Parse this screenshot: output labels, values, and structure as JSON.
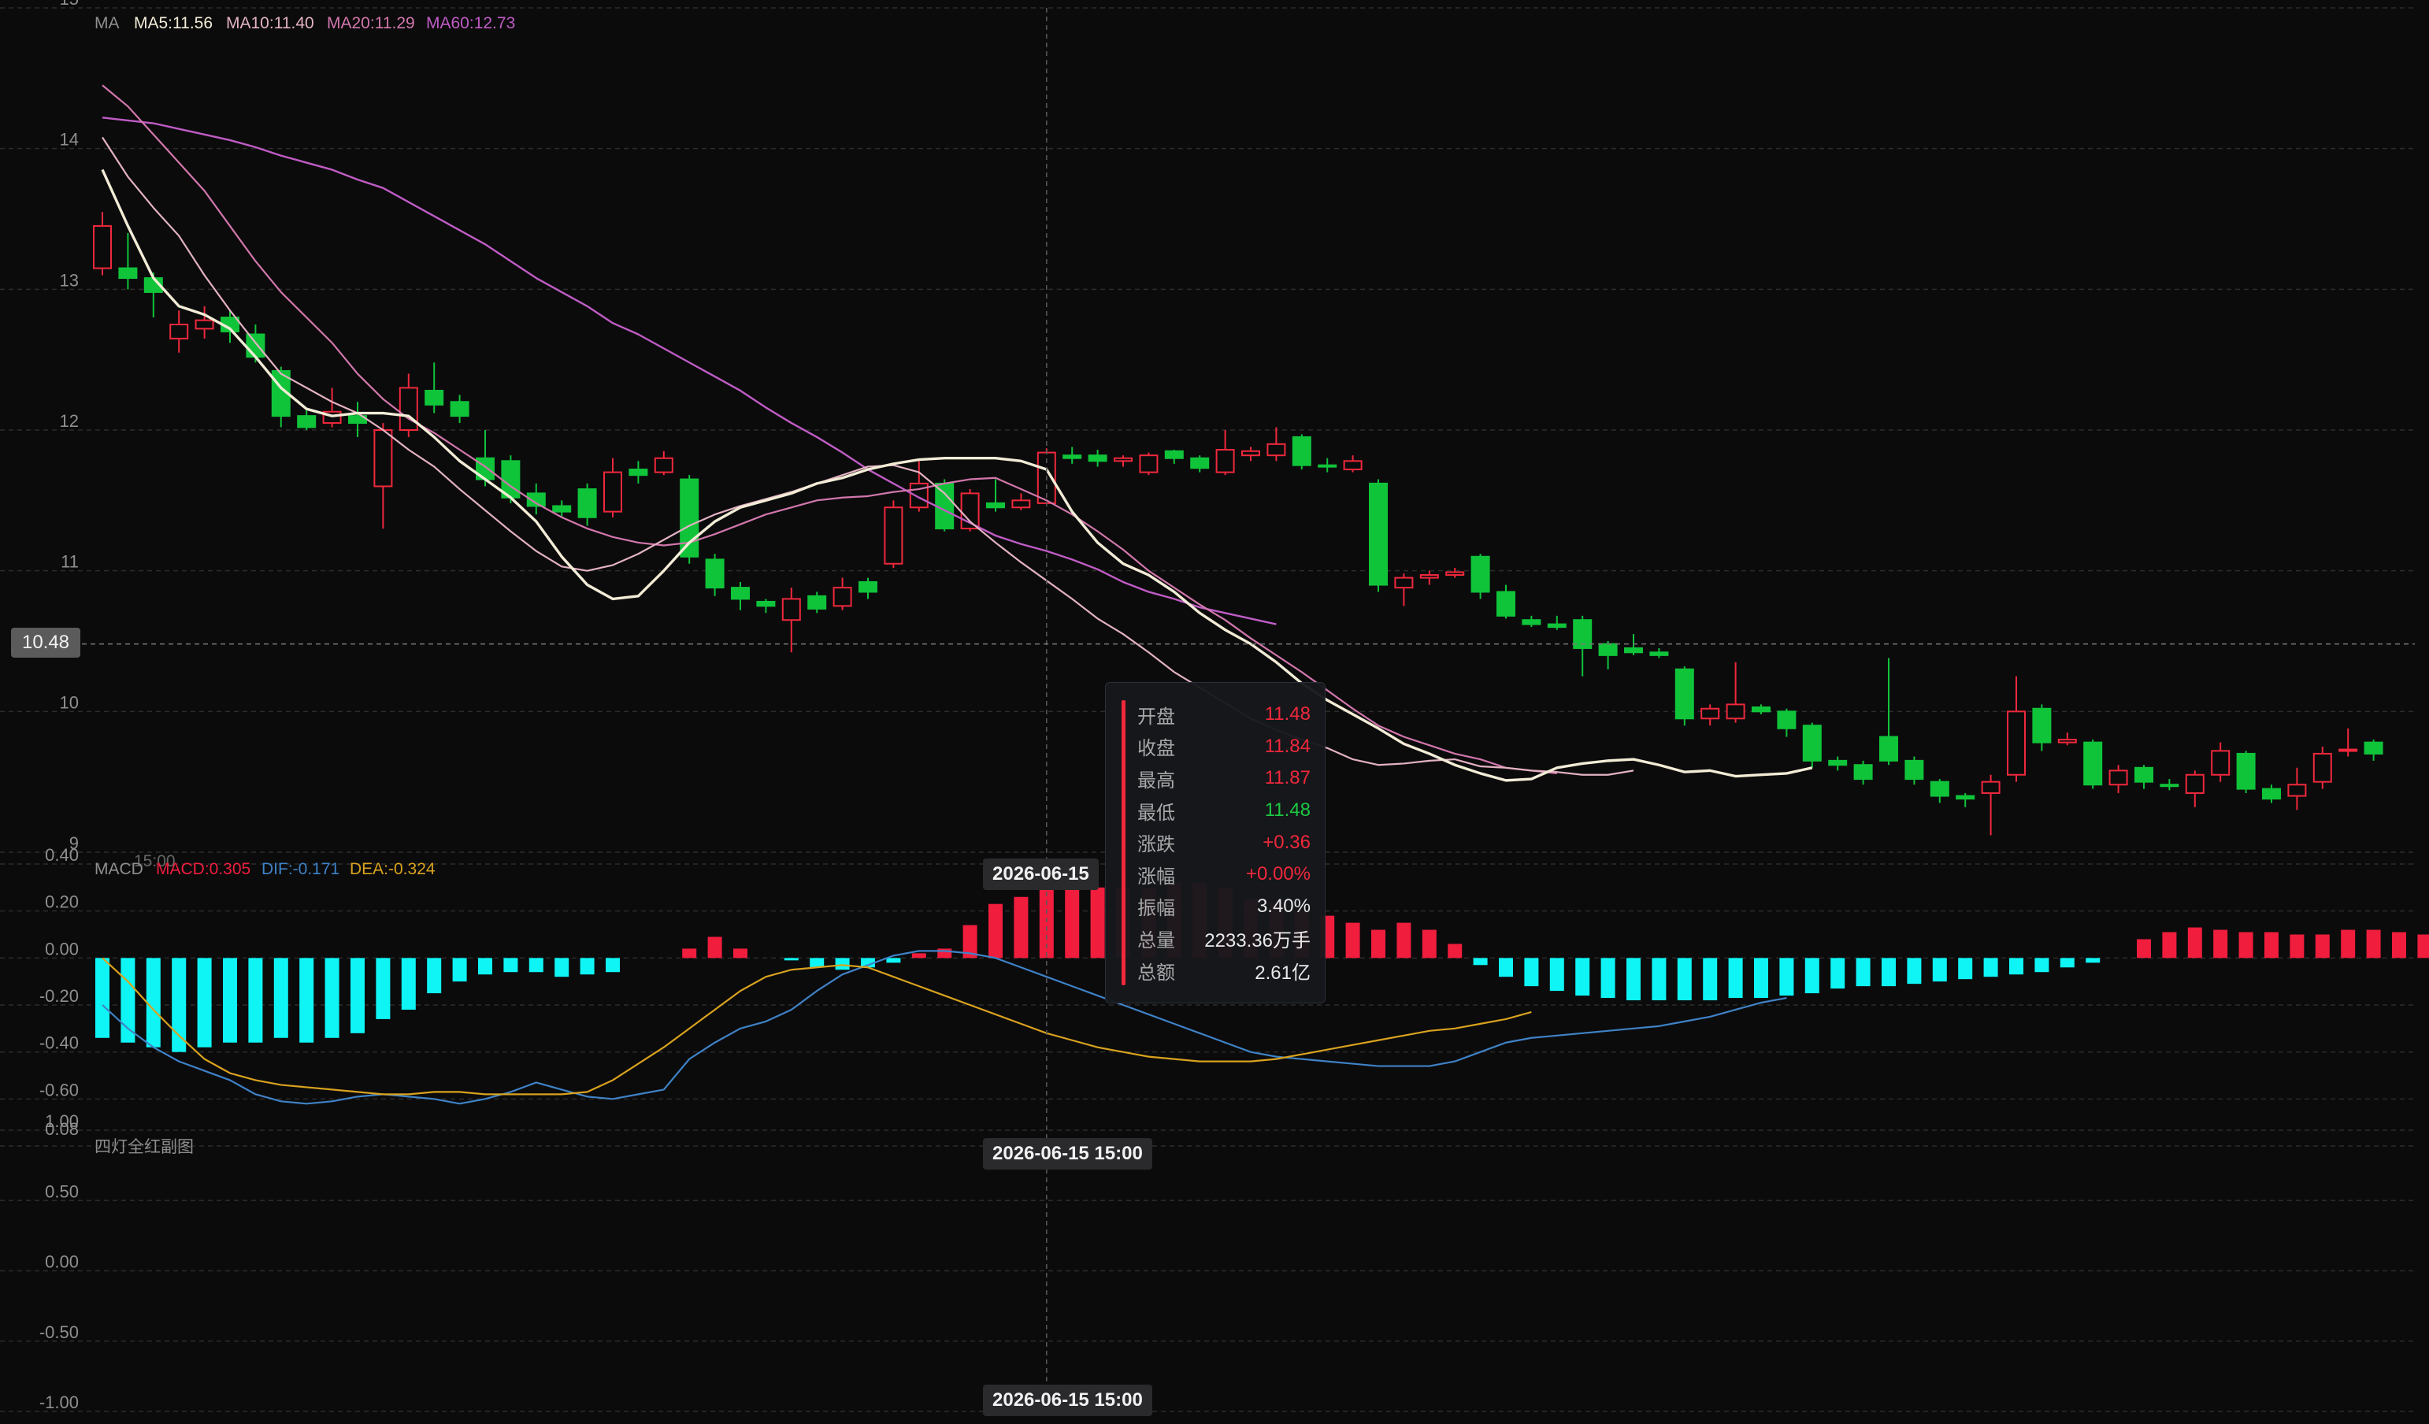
{
  "colors": {
    "up": "#f0283c",
    "down": "#10c43a",
    "ma5": "#f2ecd6",
    "ma10": "#e3b2c2",
    "ma20": "#d277ac",
    "ma60": "#c05cc5",
    "macd_pos": "#f01d3d",
    "macd_neg": "#0ff5f5",
    "dif": "#3f82c6",
    "dea": "#d9a21e",
    "grid": "#2c2c2c"
  },
  "main_legend": {
    "title": "MA",
    "ma5": "MA5:11.56",
    "ma10": "MA10:11.40",
    "ma20": "MA20:11.29",
    "ma60": "MA60:12.73"
  },
  "macd_legend": {
    "title": "MACD",
    "macd": "MACD:0.305",
    "dif": "DIF:-0.171",
    "dea": "DEA:-0.324"
  },
  "bottom_legend": {
    "title": "四灯全红副图"
  },
  "overlap_text": {
    "macd_time": "15:00",
    "bottom_tick": "0.08"
  },
  "crosshair": {
    "price_label": "10.48",
    "price_value": 10.48,
    "date_label_macd": "2026-06-15",
    "date_label_bottom1": "2026-06-15 15:00",
    "date_label_bottom2": "2026-06-15 15:00",
    "candle_index": 37
  },
  "tooltip": {
    "rows": [
      {
        "label": "开盘",
        "value": "11.48",
        "tone": "up"
      },
      {
        "label": "收盘",
        "value": "11.84",
        "tone": "up"
      },
      {
        "label": "最高",
        "value": "11.87",
        "tone": "up"
      },
      {
        "label": "最低",
        "value": "11.48",
        "tone": "down"
      },
      {
        "label": "涨跌",
        "value": "+0.36",
        "tone": "up"
      },
      {
        "label": "涨幅",
        "value": "+0.00%",
        "tone": "up"
      },
      {
        "label": "振幅",
        "value": "3.40%",
        "tone": "neutral"
      },
      {
        "label": "总量",
        "value": "2233.36万手",
        "tone": "neutral"
      },
      {
        "label": "总额",
        "value": "2.61亿",
        "tone": "neutral"
      }
    ]
  },
  "chart_data": [
    {
      "type": "candlestick",
      "title": "",
      "ylim": [
        9,
        15
      ],
      "yticks": [
        9,
        10,
        11,
        12,
        13,
        14,
        15
      ],
      "grid": true,
      "candles": [
        [
          13.15,
          13.45,
          13.55,
          13.1
        ],
        [
          13.15,
          13.08,
          13.4,
          13.0
        ],
        [
          13.08,
          12.98,
          13.12,
          12.8
        ],
        [
          12.65,
          12.75,
          12.85,
          12.55
        ],
        [
          12.72,
          12.78,
          12.88,
          12.65
        ],
        [
          12.8,
          12.7,
          12.85,
          12.62
        ],
        [
          12.68,
          12.52,
          12.75,
          12.48
        ],
        [
          12.42,
          12.1,
          12.45,
          12.02
        ],
        [
          12.1,
          12.02,
          12.15,
          12.0
        ],
        [
          12.05,
          12.13,
          12.3,
          12.02
        ],
        [
          12.1,
          12.05,
          12.2,
          11.95
        ],
        [
          11.6,
          12.0,
          12.05,
          11.3
        ],
        [
          12.0,
          12.3,
          12.4,
          11.95
        ],
        [
          12.28,
          12.18,
          12.48,
          12.12
        ],
        [
          12.2,
          12.1,
          12.25,
          12.05
        ],
        [
          11.8,
          11.65,
          12.0,
          11.6
        ],
        [
          11.78,
          11.52,
          11.82,
          11.48
        ],
        [
          11.55,
          11.46,
          11.62,
          11.4
        ],
        [
          11.46,
          11.42,
          11.5,
          11.38
        ],
        [
          11.58,
          11.38,
          11.62,
          11.32
        ],
        [
          11.42,
          11.7,
          11.8,
          11.38
        ],
        [
          11.72,
          11.68,
          11.78,
          11.62
        ],
        [
          11.7,
          11.8,
          11.85,
          11.68
        ],
        [
          11.65,
          11.1,
          11.68,
          11.05
        ],
        [
          11.08,
          10.88,
          11.12,
          10.82
        ],
        [
          10.88,
          10.8,
          10.92,
          10.72
        ],
        [
          10.78,
          10.75,
          10.8,
          10.7
        ],
        [
          10.65,
          10.8,
          10.88,
          10.42
        ],
        [
          10.82,
          10.73,
          10.85,
          10.7
        ],
        [
          10.75,
          10.88,
          10.95,
          10.72
        ],
        [
          10.92,
          10.85,
          10.95,
          10.8
        ],
        [
          11.05,
          11.45,
          11.5,
          11.02
        ],
        [
          11.45,
          11.62,
          11.78,
          11.42
        ],
        [
          11.62,
          11.3,
          11.65,
          11.28
        ],
        [
          11.3,
          11.55,
          11.58,
          11.28
        ],
        [
          11.48,
          11.45,
          11.65,
          11.42
        ],
        [
          11.45,
          11.5,
          11.55,
          11.43
        ],
        [
          11.48,
          11.84,
          11.87,
          11.48
        ],
        [
          11.82,
          11.8,
          11.88,
          11.76
        ],
        [
          11.82,
          11.78,
          11.86,
          11.74
        ],
        [
          11.78,
          11.8,
          11.82,
          11.74
        ],
        [
          11.7,
          11.82,
          11.84,
          11.68
        ],
        [
          11.85,
          11.8,
          11.86,
          11.76
        ],
        [
          11.8,
          11.73,
          11.82,
          11.7
        ],
        [
          11.7,
          11.86,
          12.0,
          11.68
        ],
        [
          11.82,
          11.85,
          11.88,
          11.78
        ],
        [
          11.82,
          11.9,
          12.02,
          11.78
        ],
        [
          11.95,
          11.75,
          11.97,
          11.72
        ],
        [
          11.75,
          11.74,
          11.8,
          11.7
        ],
        [
          11.72,
          11.78,
          11.82,
          11.7
        ],
        [
          11.62,
          10.9,
          11.65,
          10.85
        ],
        [
          10.88,
          10.95,
          10.98,
          10.75
        ],
        [
          10.95,
          10.97,
          11.0,
          10.9
        ],
        [
          10.97,
          10.99,
          11.02,
          10.95
        ],
        [
          11.1,
          10.85,
          11.12,
          10.8
        ],
        [
          10.85,
          10.68,
          10.9,
          10.66
        ],
        [
          10.65,
          10.62,
          10.68,
          10.6
        ],
        [
          10.62,
          10.6,
          10.68,
          10.58
        ],
        [
          10.65,
          10.45,
          10.68,
          10.25
        ],
        [
          10.48,
          10.4,
          10.5,
          10.3
        ],
        [
          10.45,
          10.42,
          10.55,
          10.4
        ],
        [
          10.42,
          10.4,
          10.45,
          10.38
        ],
        [
          10.3,
          9.95,
          10.32,
          9.9
        ],
        [
          9.95,
          10.02,
          10.05,
          9.9
        ],
        [
          9.95,
          10.05,
          10.35,
          9.92
        ],
        [
          10.03,
          10.0,
          10.05,
          9.98
        ],
        [
          10.0,
          9.88,
          10.02,
          9.82
        ],
        [
          9.9,
          9.65,
          9.92,
          9.6
        ],
        [
          9.65,
          9.62,
          9.68,
          9.58
        ],
        [
          9.62,
          9.52,
          9.65,
          9.48
        ],
        [
          9.82,
          9.65,
          10.38,
          9.62
        ],
        [
          9.65,
          9.52,
          9.68,
          9.48
        ],
        [
          9.5,
          9.4,
          9.52,
          9.35
        ],
        [
          9.4,
          9.38,
          9.42,
          9.32
        ],
        [
          9.42,
          9.5,
          9.55,
          9.12
        ],
        [
          9.55,
          10.0,
          10.25,
          9.5
        ],
        [
          10.02,
          9.78,
          10.05,
          9.72
        ],
        [
          9.78,
          9.8,
          9.85,
          9.76
        ],
        [
          9.78,
          9.48,
          9.8,
          9.45
        ],
        [
          9.48,
          9.58,
          9.62,
          9.42
        ],
        [
          9.6,
          9.5,
          9.62,
          9.45
        ],
        [
          9.48,
          9.47,
          9.52,
          9.44
        ],
        [
          9.42,
          9.55,
          9.58,
          9.32
        ],
        [
          9.55,
          9.72,
          9.78,
          9.5
        ],
        [
          9.7,
          9.45,
          9.72,
          9.42
        ],
        [
          9.45,
          9.38,
          9.48,
          9.35
        ],
        [
          9.4,
          9.48,
          9.6,
          9.3
        ],
        [
          9.5,
          9.7,
          9.75,
          9.45
        ],
        [
          9.72,
          9.73,
          9.88,
          9.68
        ],
        [
          9.78,
          9.7,
          9.8,
          9.65
        ]
      ],
      "ma5": [
        13.85,
        13.45,
        13.08,
        12.88,
        12.82,
        12.72,
        12.52,
        12.3,
        12.15,
        12.1,
        12.12,
        12.12,
        12.1,
        11.95,
        11.78,
        11.65,
        11.52,
        11.35,
        11.1,
        10.9,
        10.8,
        10.82,
        11.0,
        11.2,
        11.35,
        11.45,
        11.5,
        11.55,
        11.62,
        11.66,
        11.72,
        11.76,
        11.79,
        11.8,
        11.8,
        11.8,
        11.78,
        11.72,
        11.42,
        11.2,
        11.05,
        10.97,
        10.85,
        10.7,
        10.58,
        10.48,
        10.35,
        10.2,
        10.08,
        9.98,
        9.88,
        9.77,
        9.7,
        9.62,
        9.56,
        9.51,
        9.52,
        9.6,
        9.63,
        9.65,
        9.66,
        9.62,
        9.57,
        9.58,
        9.54,
        9.55,
        9.56,
        9.6
      ],
      "ma10": [
        14.08,
        13.8,
        13.58,
        13.38,
        13.1,
        12.85,
        12.62,
        12.4,
        12.3,
        12.2,
        12.12,
        12.0,
        11.86,
        11.74,
        11.58,
        11.43,
        11.28,
        11.14,
        11.03,
        11.0,
        11.04,
        11.12,
        11.22,
        11.32,
        11.4,
        11.46,
        11.51,
        11.56,
        11.62,
        11.68,
        11.74,
        11.75,
        11.7,
        11.55,
        11.35,
        11.2,
        11.06,
        10.93,
        10.8,
        10.66,
        10.55,
        10.42,
        10.28,
        10.17,
        10.06,
        9.95,
        9.87,
        9.8,
        9.74,
        9.66,
        9.62,
        9.63,
        9.65,
        9.66,
        9.61,
        9.6,
        9.58,
        9.57,
        9.55,
        9.55,
        9.58
      ],
      "ma20": [
        14.45,
        14.3,
        14.1,
        13.9,
        13.7,
        13.45,
        13.2,
        12.98,
        12.8,
        12.62,
        12.4,
        12.22,
        12.08,
        11.98,
        11.86,
        11.74,
        11.6,
        11.48,
        11.38,
        11.3,
        11.24,
        11.2,
        11.18,
        11.2,
        11.26,
        11.33,
        11.4,
        11.45,
        11.5,
        11.52,
        11.53,
        11.56,
        11.58,
        11.62,
        11.65,
        11.66,
        11.58,
        11.5,
        11.4,
        11.28,
        11.15,
        11.0,
        10.88,
        10.76,
        10.65,
        10.52,
        10.4,
        10.28,
        10.15,
        10.02,
        9.9,
        9.82,
        9.76,
        9.7,
        9.66,
        9.6,
        9.58,
        9.56
      ],
      "ma60": [
        14.22,
        14.2,
        14.18,
        14.14,
        14.1,
        14.06,
        14.01,
        13.95,
        13.9,
        13.85,
        13.78,
        13.72,
        13.62,
        13.52,
        13.42,
        13.32,
        13.2,
        13.08,
        12.98,
        12.88,
        12.76,
        12.68,
        12.58,
        12.48,
        12.38,
        12.28,
        12.16,
        12.05,
        11.95,
        11.84,
        11.72,
        11.62,
        11.52,
        11.43,
        11.34,
        11.25,
        11.19,
        11.14,
        11.08,
        11.01,
        10.92,
        10.85,
        10.8,
        10.74,
        10.7,
        10.66,
        10.62
      ]
    },
    {
      "type": "bar",
      "title": "",
      "ylim": [
        -0.8,
        0.4
      ],
      "yticks": [
        -0.8,
        -0.6,
        -0.4,
        -0.2,
        0.0,
        0.2,
        0.4
      ],
      "ytick_labels": [
        "",
        "-0.60",
        "-0.40",
        "-0.20",
        "0.00",
        "0.20",
        "0.40"
      ],
      "grid": true,
      "macd": [
        -0.34,
        -0.36,
        -0.38,
        -0.4,
        -0.38,
        -0.36,
        -0.36,
        -0.34,
        -0.36,
        -0.34,
        -0.32,
        -0.26,
        -0.22,
        -0.15,
        -0.1,
        -0.07,
        -0.06,
        -0.06,
        -0.08,
        -0.07,
        -0.06,
        0,
        0,
        0.04,
        0.09,
        0.04,
        0,
        -0.01,
        -0.04,
        -0.05,
        -0.04,
        -0.02,
        0.02,
        0.04,
        0.14,
        0.23,
        0.26,
        0.3,
        0.3,
        0.3,
        0.3,
        0.3,
        0.32,
        0.32,
        0.3,
        0.25,
        0.24,
        0.2,
        0.18,
        0.15,
        0.12,
        0.15,
        0.12,
        0.06,
        -0.03,
        -0.08,
        -0.12,
        -0.14,
        -0.16,
        -0.17,
        -0.18,
        -0.18,
        -0.18,
        -0.18,
        -0.17,
        -0.17,
        -0.16,
        -0.15,
        -0.13,
        -0.12,
        -0.12,
        -0.11,
        -0.1,
        -0.09,
        -0.08,
        -0.07,
        -0.06,
        -0.04,
        -0.02,
        0,
        0.08,
        0.11,
        0.13,
        0.12,
        0.11,
        0.11,
        0.1,
        0.1,
        0.12,
        0.12,
        0.11,
        0.1,
        0.1,
        0.13,
        0.14,
        0.15
      ],
      "dif": [
        -0.2,
        -0.3,
        -0.38,
        -0.44,
        -0.48,
        -0.52,
        -0.58,
        -0.61,
        -0.62,
        -0.61,
        -0.59,
        -0.58,
        -0.59,
        -0.6,
        -0.62,
        -0.6,
        -0.57,
        -0.53,
        -0.56,
        -0.59,
        -0.6,
        -0.58,
        -0.56,
        -0.43,
        -0.36,
        -0.3,
        -0.27,
        -0.22,
        -0.14,
        -0.07,
        -0.03,
        0.01,
        0.03,
        0.03,
        0.02,
        0,
        -0.04,
        -0.08,
        -0.12,
        -0.16,
        -0.2,
        -0.24,
        -0.28,
        -0.32,
        -0.36,
        -0.4,
        -0.42,
        -0.43,
        -0.44,
        -0.45,
        -0.46,
        -0.46,
        -0.46,
        -0.44,
        -0.4,
        -0.36,
        -0.34,
        -0.33,
        -0.32,
        -0.31,
        -0.3,
        -0.29,
        -0.27,
        -0.25,
        -0.22,
        -0.19,
        -0.17
      ],
      "dea": [
        0.0,
        -0.1,
        -0.22,
        -0.33,
        -0.43,
        -0.49,
        -0.52,
        -0.54,
        -0.55,
        -0.56,
        -0.57,
        -0.58,
        -0.58,
        -0.57,
        -0.57,
        -0.58,
        -0.58,
        -0.58,
        -0.58,
        -0.57,
        -0.52,
        -0.45,
        -0.38,
        -0.3,
        -0.22,
        -0.14,
        -0.08,
        -0.05,
        -0.04,
        -0.03,
        -0.04,
        -0.08,
        -0.12,
        -0.16,
        -0.2,
        -0.24,
        -0.28,
        -0.32,
        -0.35,
        -0.38,
        -0.4,
        -0.42,
        -0.43,
        -0.44,
        -0.44,
        -0.44,
        -0.43,
        -0.41,
        -0.39,
        -0.37,
        -0.35,
        -0.33,
        -0.31,
        -0.3,
        -0.28,
        -0.26,
        -0.23
      ]
    },
    {
      "type": "line",
      "title": "",
      "ylim": [
        -1.0,
        1.0
      ],
      "yticks": [
        -1.0,
        -0.5,
        0.0,
        0.5,
        1.0
      ],
      "ytick_labels": [
        "-1.00",
        "-0.50",
        "0.00",
        "0.50",
        "1.00"
      ],
      "grid": true
    }
  ]
}
